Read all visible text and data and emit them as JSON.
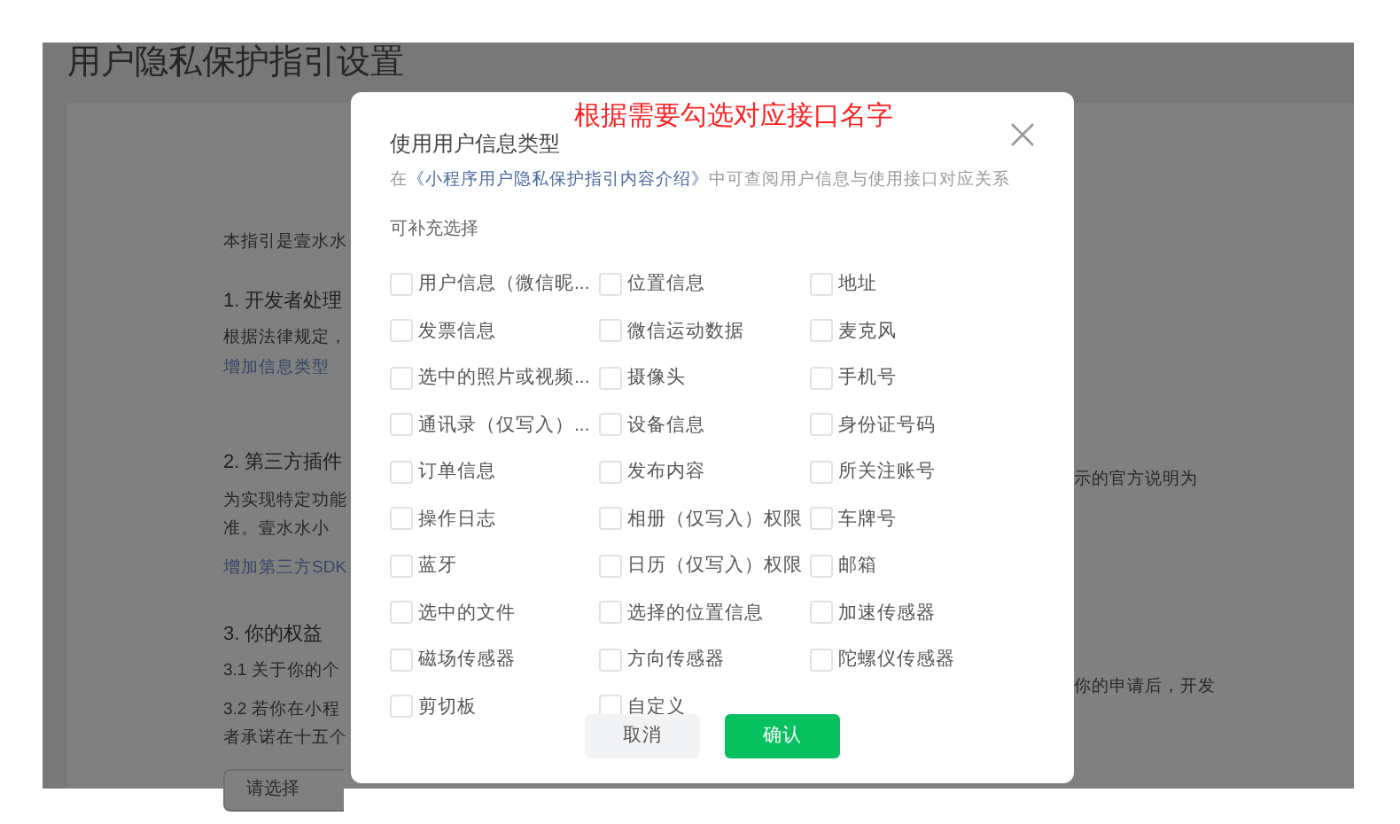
{
  "page": {
    "title": "用户隐私保护指引设置",
    "left_texts": [
      {
        "kind": "text",
        "text": "本指引是壹水水"
      },
      {
        "kind": "heading",
        "text": "1. 开发者处理"
      },
      {
        "kind": "text",
        "text": "根据法律规定，"
      },
      {
        "kind": "link",
        "text": "增加信息类型"
      },
      {
        "kind": "heading",
        "text": "2. 第三方插件"
      },
      {
        "kind": "text",
        "text": "为实现特定功能"
      },
      {
        "kind": "text",
        "text": "准。壹水水小"
      },
      {
        "kind": "link",
        "text": "增加第三方SDK"
      },
      {
        "kind": "heading",
        "text": "3. 你的权益"
      },
      {
        "kind": "text",
        "text": "3.1  关于你的个"
      },
      {
        "kind": "text",
        "text": "3.2  若你在小程"
      },
      {
        "kind": "text",
        "text": "者承诺在十五个"
      }
    ],
    "right_texts": [
      "示的官方说明为",
      "你的申请后，开发"
    ],
    "select": {
      "placeholder": "请选择"
    }
  },
  "dialog": {
    "annotation": "根据需要勾选对应接口名字",
    "heading": "使用用户信息类型",
    "hint": {
      "before": "在",
      "link": "《小程序用户隐私保护指引内容介绍》",
      "after": "中可查阅用户信息与使用接口对应关系"
    },
    "section": "可补充选择",
    "options": [
      {
        "label": "用户信息（微信昵...",
        "checked": false
      },
      {
        "label": "位置信息",
        "checked": false
      },
      {
        "label": "地址",
        "checked": false
      },
      {
        "label": "发票信息",
        "checked": false
      },
      {
        "label": "微信运动数据",
        "checked": false
      },
      {
        "label": "麦克风",
        "checked": false
      },
      {
        "label": "选中的照片或视频...",
        "checked": false
      },
      {
        "label": "摄像头",
        "checked": false
      },
      {
        "label": "手机号",
        "checked": false
      },
      {
        "label": "通讯录（仅写入）...",
        "checked": false
      },
      {
        "label": "设备信息",
        "checked": false
      },
      {
        "label": "身份证号码",
        "checked": false
      },
      {
        "label": "订单信息",
        "checked": false
      },
      {
        "label": "发布内容",
        "checked": false
      },
      {
        "label": "所关注账号",
        "checked": false
      },
      {
        "label": "操作日志",
        "checked": false
      },
      {
        "label": "相册（仅写入）权限",
        "checked": false
      },
      {
        "label": "车牌号",
        "checked": false
      },
      {
        "label": "蓝牙",
        "checked": false
      },
      {
        "label": "日历（仅写入）权限",
        "checked": false
      },
      {
        "label": "邮箱",
        "checked": false
      },
      {
        "label": "选中的文件",
        "checked": false
      },
      {
        "label": "选择的位置信息",
        "checked": false
      },
      {
        "label": "加速传感器",
        "checked": false
      },
      {
        "label": "磁场传感器",
        "checked": false
      },
      {
        "label": "方向传感器",
        "checked": false
      },
      {
        "label": "陀螺仪传感器",
        "checked": false
      },
      {
        "label": "剪切板",
        "checked": false
      },
      {
        "label": "自定义",
        "checked": false
      }
    ],
    "buttons": [
      {
        "kind": "cancel",
        "label": "取消"
      },
      {
        "kind": "confirm",
        "label": "确认"
      }
    ]
  }
}
